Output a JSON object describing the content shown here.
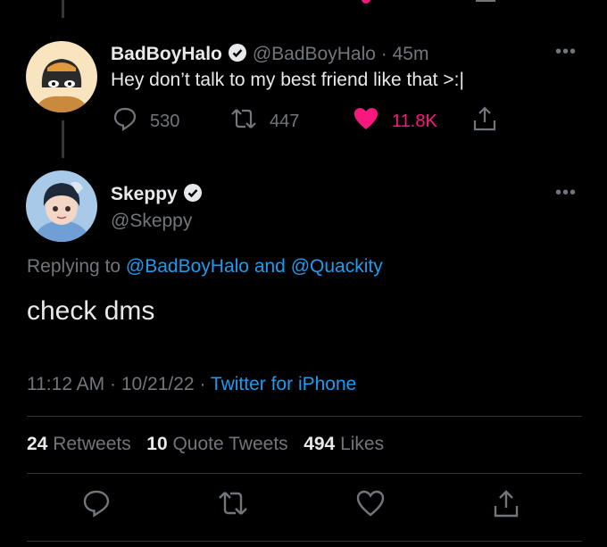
{
  "parent_tweet": {
    "display_name": "BadBoyHalo",
    "handle": "@BadBoyHalo",
    "separator": "·",
    "time_ago": "45m",
    "text": "Hey don’t talk to my best friend like that >:|",
    "replies": "530",
    "retweets": "447",
    "likes": "11.8K",
    "like_color": "#f91880"
  },
  "main_tweet": {
    "display_name": "Skeppy",
    "handle": "@Skeppy",
    "replying_prefix": "Replying to",
    "replying_user1": "@BadBoyHalo",
    "replying_and": "and",
    "replying_user2": "@Quackity",
    "text": "check dms",
    "time": "11:12 AM",
    "separator": "·",
    "date": "10/21/22",
    "separator2": "·",
    "source": "Twitter for iPhone",
    "retweets_count": "24",
    "retweets_label": "Retweets",
    "quote_count": "10",
    "quote_label": "Quote Tweets",
    "likes_count": "494",
    "likes_label": "Likes"
  },
  "colors": {
    "accent": "#1d9bf0",
    "muted": "#71767b",
    "like": "#f91880"
  },
  "icons": {
    "reply": "speech-bubble-icon",
    "retweet": "retweet-icon",
    "like": "heart-icon",
    "share": "share-icon",
    "verified": "verified-badge-icon",
    "more": "more-dots-icon"
  }
}
